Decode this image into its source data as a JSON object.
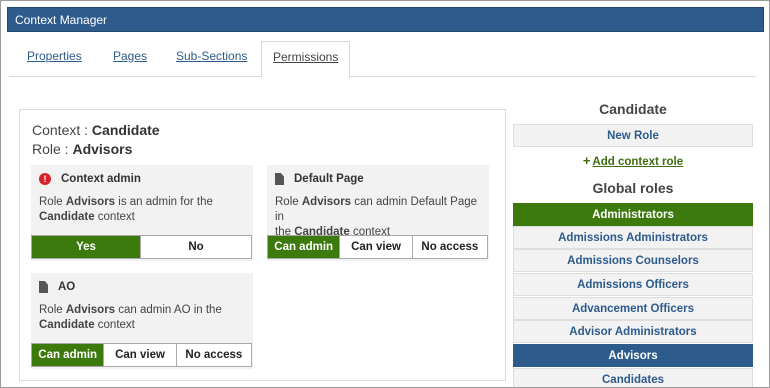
{
  "window": {
    "title": "Context Manager"
  },
  "tabs": [
    {
      "label": "Properties"
    },
    {
      "label": "Pages"
    },
    {
      "label": "Sub-Sections"
    },
    {
      "label": "Permissions"
    }
  ],
  "context": {
    "context_prefix": "Context : ",
    "context_name": "Candidate",
    "role_prefix": "Role : ",
    "role_name": "Advisors"
  },
  "cards": {
    "context_admin": {
      "icon": "alert-icon",
      "title": "Context admin",
      "desc_1": "Role ",
      "desc_role": "Advisors",
      "desc_2": " is an admin for the",
      "desc_ctx": "Candidate",
      "desc_3": " context",
      "options": [
        "Yes",
        "No"
      ],
      "selected": "Yes"
    },
    "default_page": {
      "icon": "document-icon",
      "title": "Default Page",
      "desc_1": "Role ",
      "desc_role": "Advisors",
      "desc_2": " can admin Default Page in",
      "desc_3": "the ",
      "desc_ctx": "Candidate",
      "desc_4": " context",
      "options": [
        "Can admin",
        "Can view",
        "No access"
      ],
      "selected": "Can admin"
    },
    "ao": {
      "icon": "document-icon",
      "title": "AO",
      "desc_1": "Role ",
      "desc_role": "Advisors",
      "desc_2": " can admin AO in the",
      "desc_ctx": "Candidate",
      "desc_3": " context",
      "options": [
        "Can admin",
        "Can view",
        "No access"
      ],
      "selected": "Can admin"
    }
  },
  "sidebar": {
    "context_heading": "Candidate",
    "new_role": "New Role",
    "add_context_role": "Add context role",
    "global_heading": "Global roles",
    "roles": [
      {
        "label": "Administrators",
        "state": "green"
      },
      {
        "label": "Admissions Administrators",
        "state": ""
      },
      {
        "label": "Admissions Counselors",
        "state": ""
      },
      {
        "label": "Admissions Officers",
        "state": ""
      },
      {
        "label": "Advancement Officers",
        "state": ""
      },
      {
        "label": "Advisor Administrators",
        "state": ""
      },
      {
        "label": "Advisors",
        "state": "blue"
      },
      {
        "label": "Candidates",
        "state": ""
      }
    ]
  },
  "colors": {
    "brand_blue": "#2d5b8c",
    "active_green": "#3d7a0e",
    "alert_red": "#d8232a"
  }
}
